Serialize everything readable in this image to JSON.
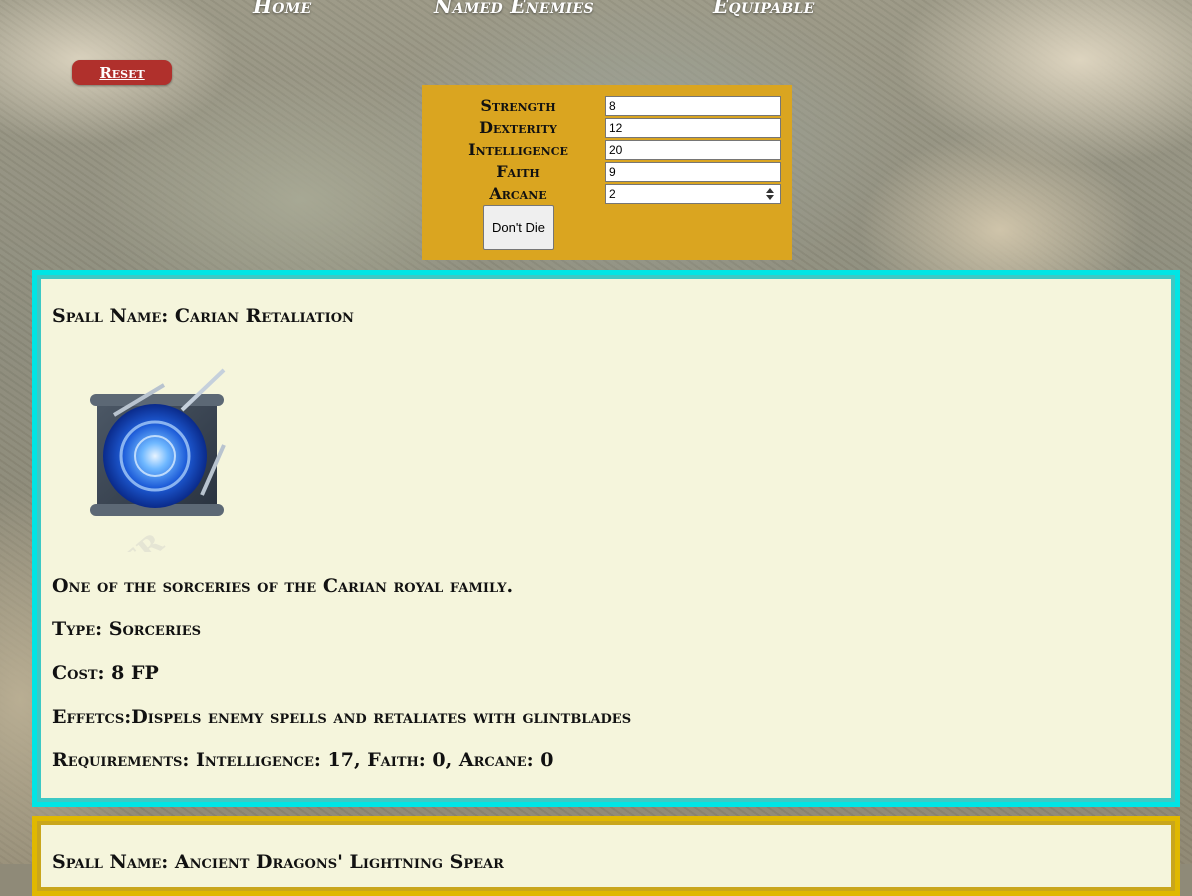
{
  "nav": {
    "home": "Home",
    "named_enemies": "Named Enemies",
    "equipable": "Equipable"
  },
  "reset_label": "Reset",
  "stats": [
    {
      "label": "Strength",
      "value": "8"
    },
    {
      "label": "Dexterity",
      "value": "12"
    },
    {
      "label": "Intelligence",
      "value": "20"
    },
    {
      "label": "Faith",
      "value": "9"
    },
    {
      "label": "Arcane",
      "value": "2"
    }
  ],
  "dont_die_label": "Don't Die",
  "spells": [
    {
      "name": "Spall Name: Carian Retaliation",
      "description": "One of the sorceries of the Carian royal family.",
      "type": "Type: Sorceries",
      "cost": "Cost: 8 FP",
      "effects": "Effetcs:Dispels enemy spells and retaliates with glintblades",
      "requirements": "Requirements: Intelligence: 17, Faith: 0, Arcane: 0",
      "image_icon": "sorcery-scroll-icon",
      "border_color": "#00e5e5"
    },
    {
      "name": "Spall Name: Ancient Dragons' Lightning Spear",
      "border_color": "#e0b800"
    }
  ],
  "colors": {
    "stats_panel": "#daa520",
    "reset_button": "#b0302c",
    "card_background": "#f5f5dc"
  }
}
